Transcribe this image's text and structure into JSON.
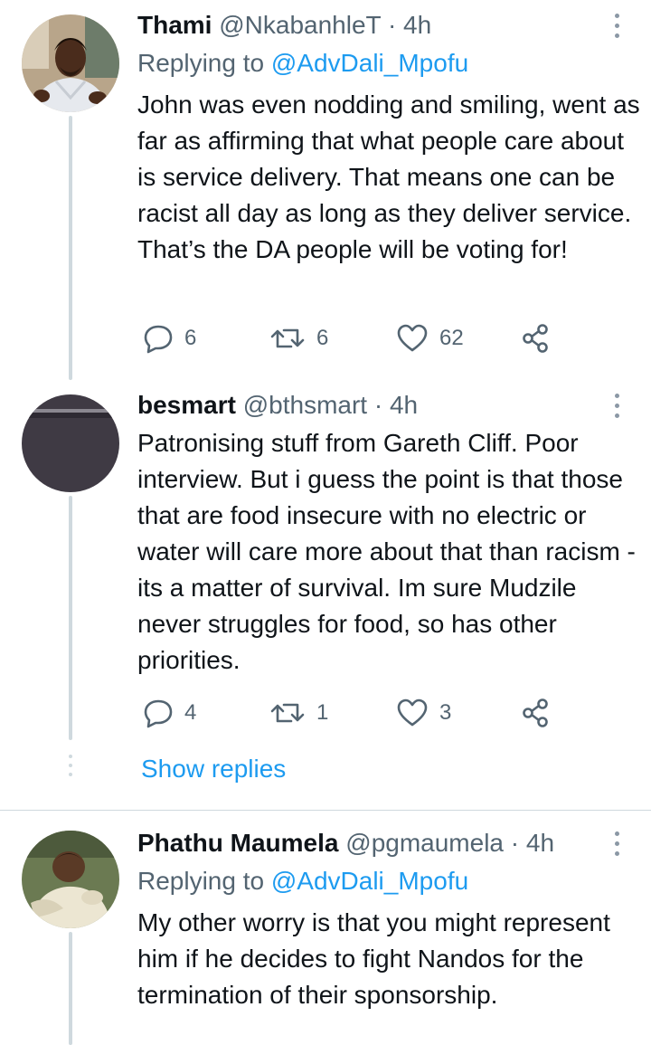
{
  "tweets": [
    {
      "name": "Thami",
      "handle": "@NkabanhleT",
      "time": "4h",
      "replying_prefix": "Replying to ",
      "replying_to": "@AdvDali_Mpofu",
      "text": "John was even nodding and smiling, went as far as affirming that what people care about is service delivery. That means one can be racist all day as long as they deliver service. That’s the DA people will be voting for!",
      "replies": "6",
      "retweets": "6",
      "likes": "62",
      "avatar_icon": "person-photo"
    },
    {
      "name": "besmart",
      "handle": "@bthsmart",
      "time": "4h",
      "text": "Patronising stuff from Gareth Cliff. Poor interview. But i guess the point is that those that are food insecure with no electric or water will care more about that than racism - its a matter of survival. Im sure Mudzile never struggles for food, so has other priorities.",
      "replies": "4",
      "retweets": "1",
      "likes": "3",
      "show_replies": "Show replies",
      "avatar_icon": "dark-avatar"
    },
    {
      "name": "Phathu Maumela",
      "handle": "@pgmaumela",
      "time": "4h",
      "replying_prefix": "Replying to ",
      "replying_to": "@AdvDali_Mpofu",
      "text": "My other worry is that you might represent him if he decides to fight Nandos for the termination of their sponsorship.",
      "avatar_icon": "baby-photo"
    }
  ],
  "separator": "·",
  "colors": {
    "text": "#0f1419",
    "secondary": "#536471",
    "link": "#1d9bf0",
    "thread": "#cfd9de"
  }
}
